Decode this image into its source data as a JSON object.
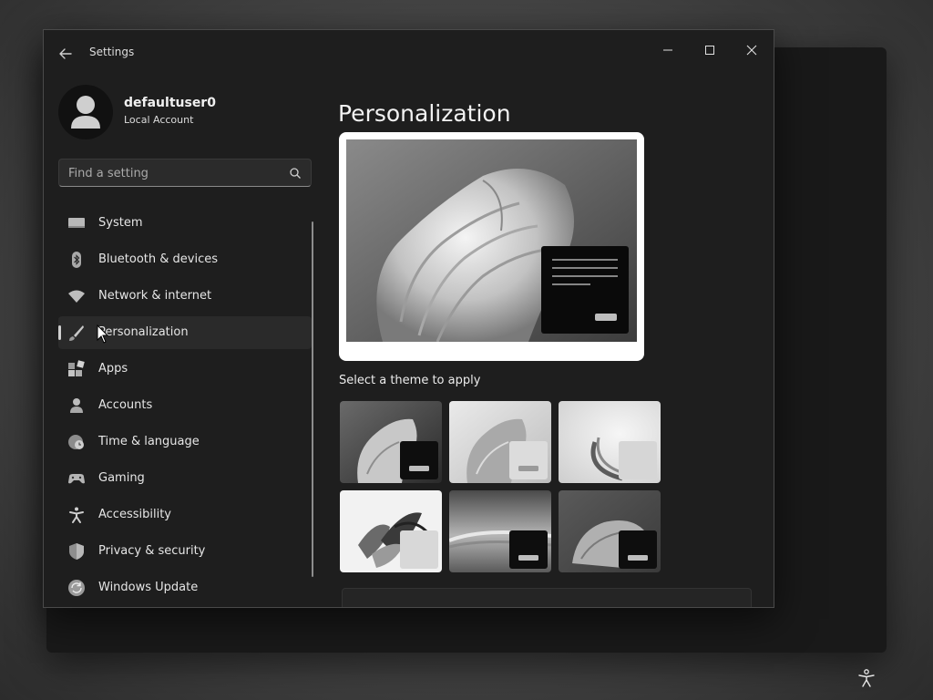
{
  "window": {
    "title": "Settings"
  },
  "profile": {
    "name": "defaultuser0",
    "account_type": "Local Account"
  },
  "search": {
    "placeholder": "Find a setting"
  },
  "sidebar": {
    "items": [
      {
        "label": "System",
        "icon": "monitor-icon",
        "active": false
      },
      {
        "label": "Bluetooth & devices",
        "icon": "bluetooth-icon",
        "active": false
      },
      {
        "label": "Network & internet",
        "icon": "wifi-icon",
        "active": false
      },
      {
        "label": "Personalization",
        "icon": "paintbrush-icon",
        "active": true
      },
      {
        "label": "Apps",
        "icon": "apps-icon",
        "active": false
      },
      {
        "label": "Accounts",
        "icon": "person-icon",
        "active": false
      },
      {
        "label": "Time & language",
        "icon": "globe-clock-icon",
        "active": false
      },
      {
        "label": "Gaming",
        "icon": "gamepad-icon",
        "active": false
      },
      {
        "label": "Accessibility",
        "icon": "accessibility-icon",
        "active": false
      },
      {
        "label": "Privacy & security",
        "icon": "shield-icon",
        "active": false
      },
      {
        "label": "Windows Update",
        "icon": "refresh-icon",
        "active": false
      }
    ]
  },
  "main": {
    "title": "Personalization",
    "themes_label": "Select a theme to apply",
    "themes": [
      {
        "name": "windows-dark",
        "window_color": "#0e0e0e"
      },
      {
        "name": "windows-light",
        "window_color": "#dcdcdc"
      },
      {
        "name": "glow",
        "window_color": "#d6d6d6"
      },
      {
        "name": "captured-motion",
        "window_color": "#d8d8d8"
      },
      {
        "name": "sunrise",
        "window_color": "#0e0e0e"
      },
      {
        "name": "flow",
        "window_color": "#0e0e0e"
      }
    ]
  }
}
